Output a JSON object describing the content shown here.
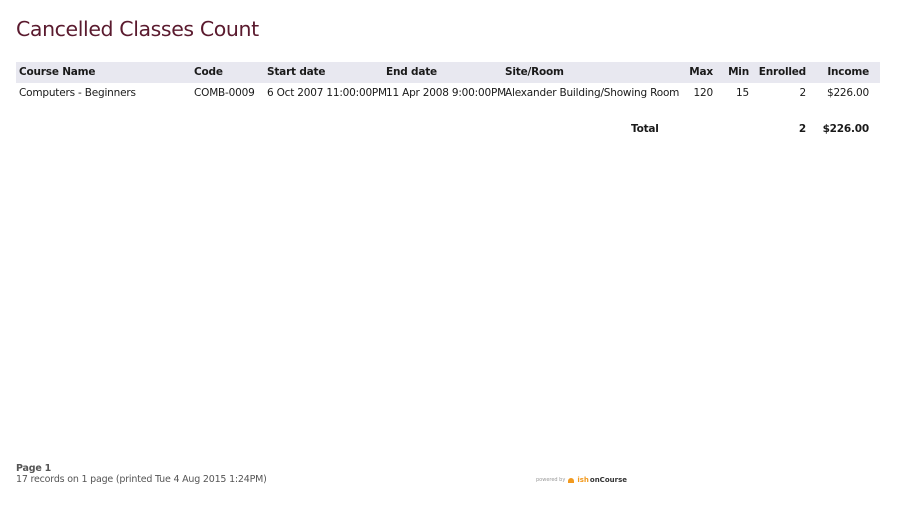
{
  "report": {
    "title": "Cancelled Classes Count",
    "columns": {
      "course_name": "Course Name",
      "code": "Code",
      "start_date": "Start date",
      "end_date": "End date",
      "site_room": "Site/Room",
      "max": "Max",
      "min": "Min",
      "enrolled": "Enrolled",
      "income": "Income"
    },
    "rows": [
      {
        "course_name": "Computers - Beginners",
        "code": "COMB-0009",
        "start_date": "6 Oct 2007 11:00:00PM",
        "end_date": "11 Apr 2008 9:00:00PM",
        "site_room": "Alexander Building/Showing Room",
        "max": "120",
        "min": "15",
        "enrolled": "2",
        "income": "$226.00"
      }
    ],
    "total": {
      "label": "Total",
      "enrolled": "2",
      "income": "$226.00"
    }
  },
  "footer": {
    "page": "Page 1",
    "summary": "17 records on 1 page (printed Tue 4 Aug 2015 1:24PM)",
    "powered_by": "powered by",
    "brand_ish": "ish",
    "brand_oncourse": "onCourse"
  }
}
